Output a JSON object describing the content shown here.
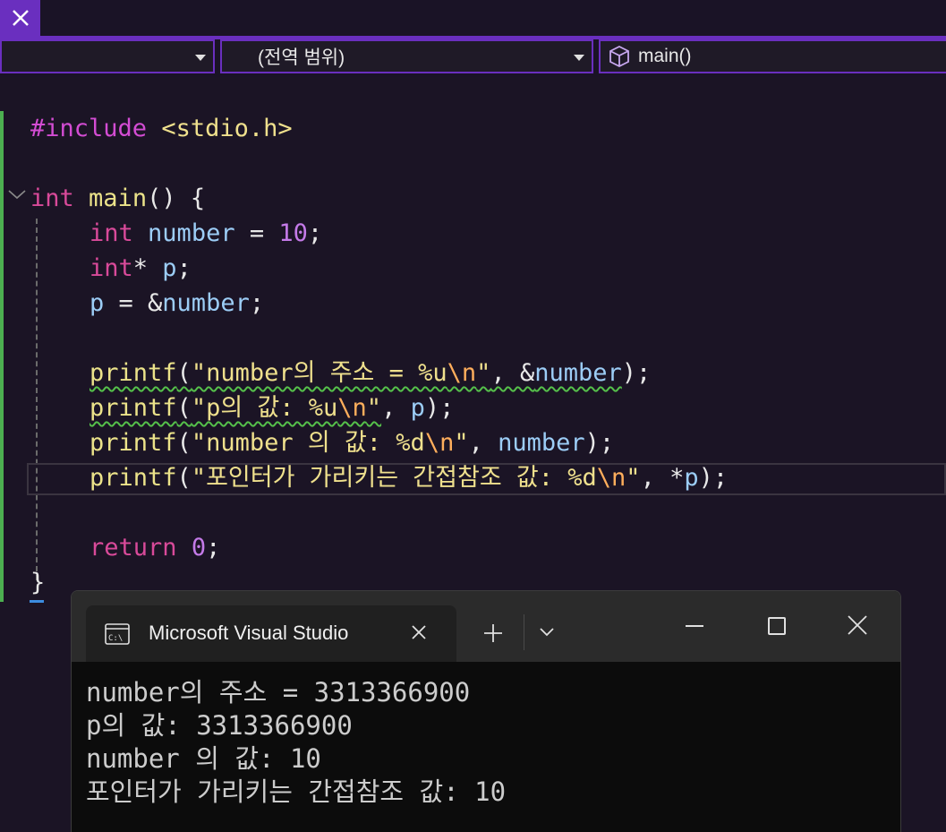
{
  "nav": {
    "scope": "(전역 범위)",
    "member": "main()"
  },
  "code": {
    "l1": {
      "pre": "#include",
      "hdr": "<stdio.h>"
    },
    "l3": {
      "type": "int",
      "fn": "main",
      "rest": "() {"
    },
    "l4": {
      "type": "int",
      "var": "number",
      "eq": " = ",
      "num": "10",
      "end": ";"
    },
    "l5": {
      "type": "int",
      "star": "* ",
      "var": "p",
      "end": ";"
    },
    "l6": {
      "var": "p",
      "eq": " = &",
      "var2": "number",
      "end": ";"
    },
    "l8": {
      "fn": "printf",
      "open": "(",
      "str": "\"number의 주소 = %u",
      "esc": "\\n",
      "strend": "\"",
      "mid": ", &",
      "var": "number",
      "end": ");"
    },
    "l9": {
      "fn": "printf",
      "open": "(",
      "str": "\"p의 값: %u",
      "esc": "\\n",
      "strend": "\"",
      "mid": ", ",
      "var": "p",
      "end": ");"
    },
    "l10": {
      "fn": "printf",
      "open": "(",
      "str": "\"number 의 값: %d",
      "esc": "\\n",
      "strend": "\"",
      "mid": ", ",
      "var": "number",
      "end": ");"
    },
    "l11": {
      "fn": "printf",
      "open": "(",
      "str": "\"포인터가 가리키는 간접참조 값: %d",
      "esc": "\\n",
      "strend": "\"",
      "mid": ", *",
      "var": "p",
      "end": ");"
    },
    "l13": {
      "kw": "return",
      "sp": " ",
      "num": "0",
      "end": ";"
    },
    "l14": {
      "brace": "}"
    }
  },
  "console": {
    "title": "Microsoft Visual Studio",
    "output": [
      "number의 주소 = 3313366900",
      "p의 값: 3313366900",
      "number 의 값: 10",
      "포인터가 가리키는 간접참조 값: 10"
    ]
  },
  "colors": {
    "accent": "#6a2fbf",
    "editor_bg": "#1b1425",
    "keyword": "#d94a9a",
    "function": "#ece38a",
    "variable": "#9ccdf6",
    "number": "#c47ae8",
    "change_bar": "#4caf50"
  }
}
